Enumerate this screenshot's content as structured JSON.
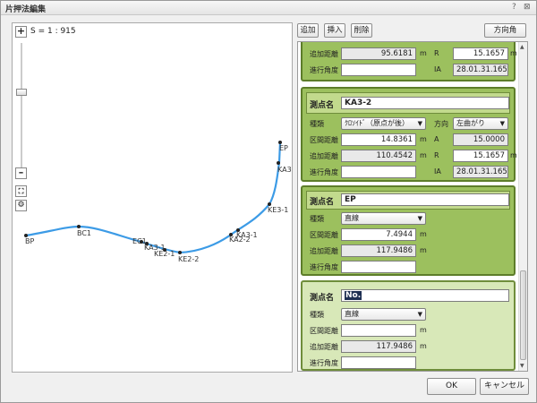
{
  "window": {
    "title": "片押法編集",
    "help": "?",
    "close": "⊠"
  },
  "map": {
    "scale": "S = 1 : 915",
    "zoom_in": "+",
    "zoom_out": "–",
    "fit": "⛶",
    "settings": "⚙",
    "points": [
      "BP",
      "BC1",
      "EC1",
      "KA3-1",
      "KE2-1",
      "KE2-2",
      "KA2-2",
      "KA3-1",
      "KE3-1",
      "KA3",
      "EP"
    ]
  },
  "toolbar": {
    "add": "追加",
    "insert": "挿入",
    "delete": "削除",
    "direction": "方向角"
  },
  "card0": {
    "added_label": "追加距離",
    "added_value": "95.6181",
    "unit_m": "m",
    "r_label": "R",
    "r_value": "15.1657",
    "r_unit": "m",
    "angle_label": "進行角度",
    "ia_label": "IA",
    "ia_value": "28.01.31.1652"
  },
  "card1": {
    "point_label": "測点名",
    "point_value": "KA3-2",
    "type_label": "種類",
    "type_value": "ｸﾛｿｲﾄﾞ（原点が後）",
    "dir_label": "方向",
    "dir_value": "左曲がり",
    "dist_label": "区間距離",
    "dist_value": "14.8361",
    "unit_m": "m",
    "a_label": "A",
    "a_value": "15.0000",
    "added_label": "追加距離",
    "added_value": "110.4542",
    "r_label": "R",
    "r_value": "15.1657",
    "angle_label": "進行角度",
    "ia_label": "IA",
    "ia_value": "28.01.31.1652"
  },
  "card2": {
    "point_label": "測点名",
    "point_value": "EP",
    "type_label": "種類",
    "type_value": "直線",
    "dist_label": "区間距離",
    "dist_value": "7.4944",
    "unit_m": "m",
    "added_label": "追加距離",
    "added_value": "117.9486",
    "angle_label": "進行角度"
  },
  "card3": {
    "point_label": "測点名",
    "point_value": "No.",
    "type_label": "種類",
    "type_value": "直線",
    "dist_label": "区間距離",
    "dist_value": "",
    "unit_m": "m",
    "added_label": "追加距離",
    "added_value": "117.9486",
    "angle_label": "進行角度"
  },
  "buttons": {
    "ok": "OK",
    "cancel": "キャンセル"
  },
  "colors": {
    "curve": "#3c9be6",
    "card": "#9cc05e",
    "card_border": "#5d7d2a",
    "selected_bg": "#1e2f52"
  }
}
